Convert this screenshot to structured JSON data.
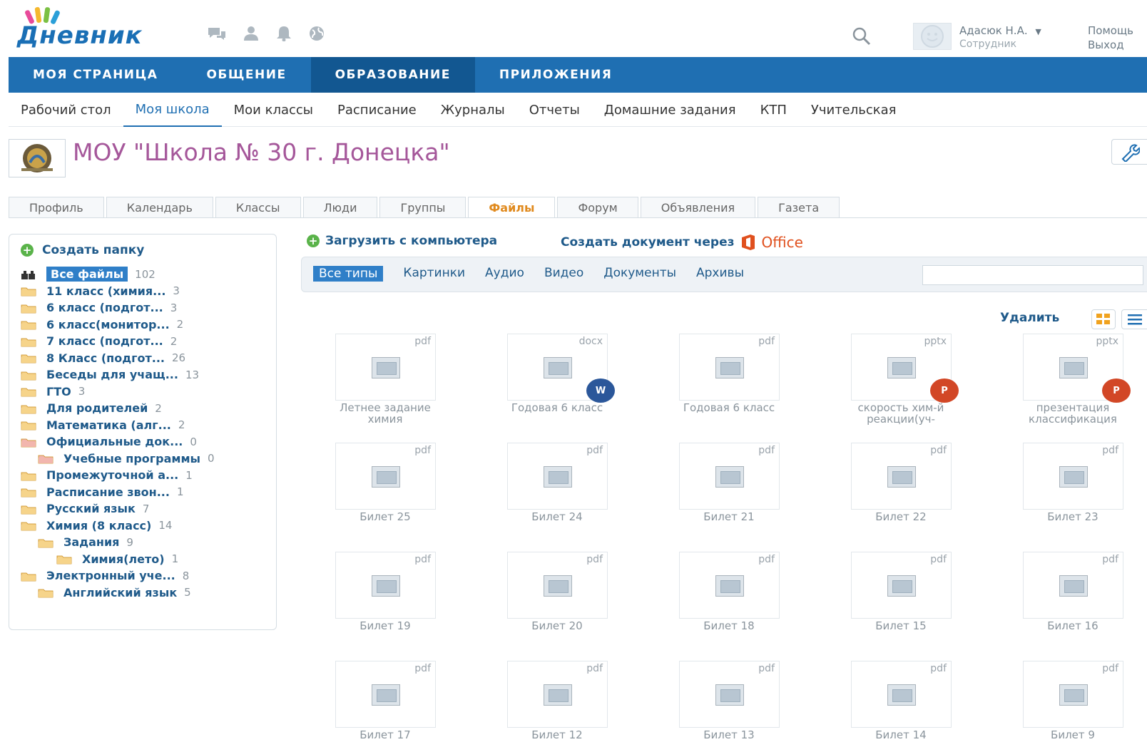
{
  "header": {
    "logo_text": "Дневник",
    "user_name": "Адасюк Н.А.",
    "user_role": "Сотрудник",
    "help": "Помощь",
    "exit": "Выход"
  },
  "mainnav": [
    {
      "label": "МОЯ СТРАНИЦА",
      "active": false
    },
    {
      "label": "ОБЩЕНИЕ",
      "active": false
    },
    {
      "label": "ОБРАЗОВАНИЕ",
      "active": true
    },
    {
      "label": "ПРИЛОЖЕНИЯ",
      "active": false
    }
  ],
  "subnav": [
    {
      "label": "Рабочий стол",
      "active": false
    },
    {
      "label": "Моя школа",
      "active": true
    },
    {
      "label": "Мои классы",
      "active": false
    },
    {
      "label": "Расписание",
      "active": false
    },
    {
      "label": "Журналы",
      "active": false
    },
    {
      "label": "Отчеты",
      "active": false
    },
    {
      "label": "Домашние задания",
      "active": false
    },
    {
      "label": "КТП",
      "active": false
    },
    {
      "label": "Учительская",
      "active": false
    }
  ],
  "school": {
    "title": "МОУ \"Школа № 30 г. Донецка\""
  },
  "tabs": [
    {
      "label": "Профиль",
      "active": false
    },
    {
      "label": "Календарь",
      "active": false
    },
    {
      "label": "Классы",
      "active": false
    },
    {
      "label": "Люди",
      "active": false
    },
    {
      "label": "Группы",
      "active": false
    },
    {
      "label": "Файлы",
      "active": true
    },
    {
      "label": "Форум",
      "active": false
    },
    {
      "label": "Объявления",
      "active": false
    },
    {
      "label": "Газета",
      "active": false
    }
  ],
  "sidebar": {
    "create_folder": "Создать папку",
    "folders": [
      {
        "label": "Все файлы",
        "count": "102",
        "level": 0,
        "selected": true,
        "icon": "all"
      },
      {
        "label": "11 класс (химия...",
        "count": "3",
        "level": 0,
        "icon": "folder"
      },
      {
        "label": "6 класс (подгот...",
        "count": "3",
        "level": 0,
        "icon": "folder"
      },
      {
        "label": "6 класс(монитор...",
        "count": "2",
        "level": 0,
        "icon": "folder"
      },
      {
        "label": "7 класс (подгот...",
        "count": "2",
        "level": 0,
        "icon": "folder"
      },
      {
        "label": "8 Класс (подгот...",
        "count": "26",
        "level": 0,
        "icon": "folder"
      },
      {
        "label": "Беседы для учащ...",
        "count": "13",
        "level": 0,
        "icon": "folder"
      },
      {
        "label": "ГТО",
        "count": "3",
        "level": 0,
        "icon": "folder"
      },
      {
        "label": "Для родителей",
        "count": "2",
        "level": 0,
        "icon": "folder"
      },
      {
        "label": "Математика (алг...",
        "count": "2",
        "level": 0,
        "icon": "folder"
      },
      {
        "label": "Официальные док...",
        "count": "0",
        "level": 0,
        "icon": "folder-red"
      },
      {
        "label": "Учебные программы",
        "count": "0",
        "level": 1,
        "icon": "folder-red"
      },
      {
        "label": "Промежуточной а...",
        "count": "1",
        "level": 0,
        "icon": "folder"
      },
      {
        "label": "Расписание звон...",
        "count": "1",
        "level": 0,
        "icon": "folder"
      },
      {
        "label": "Русский язык",
        "count": "7",
        "level": 0,
        "icon": "folder"
      },
      {
        "label": "Химия (8 класс)",
        "count": "14",
        "level": 0,
        "icon": "folder"
      },
      {
        "label": "Задания",
        "count": "9",
        "level": 1,
        "icon": "folder"
      },
      {
        "label": "Химия(лето)",
        "count": "1",
        "level": 2,
        "icon": "folder"
      },
      {
        "label": "Электронный уче...",
        "count": "8",
        "level": 0,
        "icon": "folder"
      },
      {
        "label": "Английский язык",
        "count": "5",
        "level": 1,
        "icon": "folder"
      }
    ]
  },
  "actions": {
    "upload": "Загрузить с компьютера",
    "create_doc": "Создать документ через",
    "office": "Office",
    "delete": "Удалить"
  },
  "filters": [
    {
      "label": "Все типы",
      "active": true
    },
    {
      "label": "Картинки",
      "active": false
    },
    {
      "label": "Аудио",
      "active": false
    },
    {
      "label": "Видео",
      "active": false
    },
    {
      "label": "Документы",
      "active": false
    },
    {
      "label": "Архивы",
      "active": false
    }
  ],
  "files": [
    {
      "name": "Летнее задание химия",
      "ext": "pdf",
      "badge": ""
    },
    {
      "name": "Годовая 6 класс",
      "ext": "docx",
      "badge": "word"
    },
    {
      "name": "Годовая 6 класс",
      "ext": "pdf",
      "badge": ""
    },
    {
      "name": "скорость хим-й реакции(уч-",
      "ext": "pptx",
      "badge": "ppt"
    },
    {
      "name": "презентация классификация",
      "ext": "pptx",
      "badge": "ppt"
    },
    {
      "name": "Билет 25",
      "ext": "pdf",
      "badge": ""
    },
    {
      "name": "Билет 24",
      "ext": "pdf",
      "badge": ""
    },
    {
      "name": "Билет 21",
      "ext": "pdf",
      "badge": ""
    },
    {
      "name": "Билет 22",
      "ext": "pdf",
      "badge": ""
    },
    {
      "name": "Билет 23",
      "ext": "pdf",
      "badge": ""
    },
    {
      "name": "Билет 19",
      "ext": "pdf",
      "badge": ""
    },
    {
      "name": "Билет 20",
      "ext": "pdf",
      "badge": ""
    },
    {
      "name": "Билет 18",
      "ext": "pdf",
      "badge": ""
    },
    {
      "name": "Билет 15",
      "ext": "pdf",
      "badge": ""
    },
    {
      "name": "Билет 16",
      "ext": "pdf",
      "badge": ""
    },
    {
      "name": "Билет 17",
      "ext": "pdf",
      "badge": ""
    },
    {
      "name": "Билет 12",
      "ext": "pdf",
      "badge": ""
    },
    {
      "name": "Билет 13",
      "ext": "pdf",
      "badge": ""
    },
    {
      "name": "Билет 14",
      "ext": "pdf",
      "badge": ""
    },
    {
      "name": "Билет 9",
      "ext": "pdf",
      "badge": ""
    }
  ],
  "colors": {
    "nav_blue": "#1f6fb2",
    "nav_active": "#125791",
    "school_title": "#a5579a",
    "active_tab": "#e08a1e",
    "link_blue": "#1f5a8a"
  }
}
